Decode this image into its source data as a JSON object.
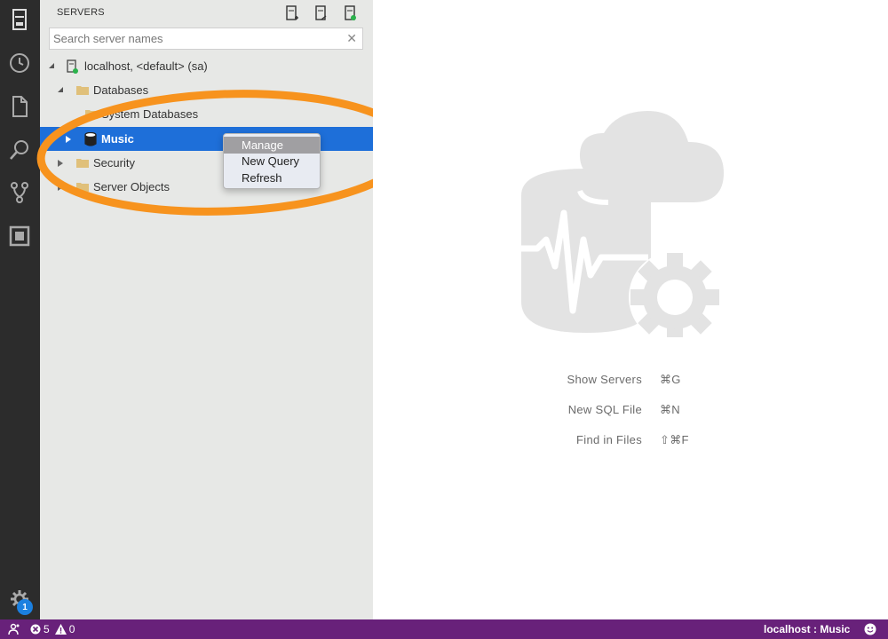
{
  "sidebar": {
    "title": "SERVERS",
    "search_placeholder": "Search server names",
    "tree": {
      "server": "localhost, <default> (sa)",
      "databases": "Databases",
      "system_databases": "System Databases",
      "music": "Music",
      "security": "Security",
      "server_objects": "Server Objects"
    }
  },
  "context_menu": {
    "items": [
      "Manage",
      "New Query",
      "Refresh"
    ]
  },
  "main": {
    "shortcuts": [
      {
        "label": "Show Servers",
        "key": "⌘G"
      },
      {
        "label": "New SQL File",
        "key": "⌘N"
      },
      {
        "label": "Find in Files",
        "key": "⇧⌘F"
      }
    ]
  },
  "activity_bar": {
    "settings_badge": "1"
  },
  "statusbar": {
    "errors": "5",
    "warnings": "0",
    "connection": "localhost : Music"
  },
  "colors": {
    "statusbar": "#68217a",
    "selection": "#1e6fd9",
    "highlight_ring": "#f7931e"
  }
}
